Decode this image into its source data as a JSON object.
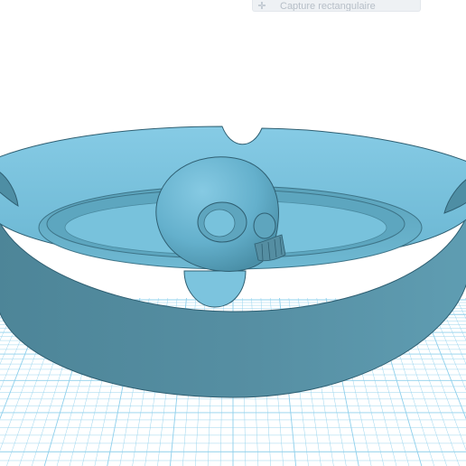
{
  "toolbar": {
    "capture_label": "Capture rectangulaire",
    "capture_icon": "crosshair-icon"
  },
  "scene": {
    "grid_color": "#8fd0ec",
    "model_color": "#6bbbd6",
    "model_dark": "#4f8ea3",
    "model_light": "#8dd0ea",
    "outline_color": "#2f5f72"
  }
}
